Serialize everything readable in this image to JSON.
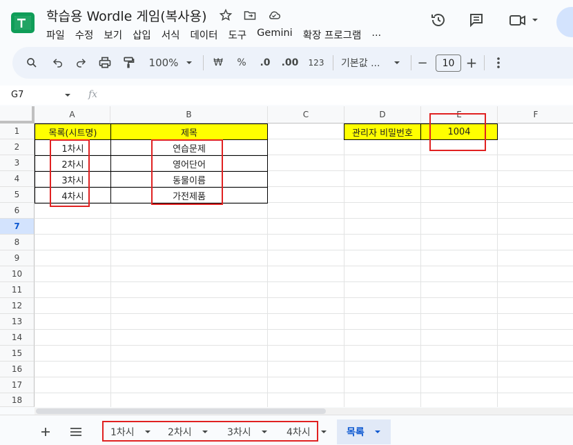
{
  "doc": {
    "title": "학습용 Wordle 게임(복사용)"
  },
  "menu": [
    "파일",
    "수정",
    "보기",
    "삽입",
    "서식",
    "데이터",
    "도구",
    "Gemini",
    "확장 프로그램",
    "..."
  ],
  "toolbar": {
    "zoom": "100%",
    "currency": "₩",
    "percent": "%",
    "decimal_decrease": ".0",
    "decimal_increase": ".00",
    "number_format": "123",
    "font": "기본값 ...",
    "font_size": "10",
    "minus": "−",
    "plus": "+"
  },
  "formula_bar": {
    "cell_ref": "G7",
    "fx": "fx"
  },
  "columns": [
    "A",
    "B",
    "C",
    "D",
    "E",
    "F"
  ],
  "rows": [
    "1",
    "2",
    "3",
    "4",
    "5",
    "6",
    "7",
    "8",
    "9",
    "10",
    "11",
    "12",
    "13",
    "14",
    "15",
    "16",
    "17",
    "18"
  ],
  "selected_row": "7",
  "cells": {
    "A1": "목록(시트명)",
    "B1": "제목",
    "A2": "1차시",
    "B2": "연습문제",
    "A3": "2차시",
    "B3": "영어단어",
    "A4": "3차시",
    "B4": "동물이름",
    "A5": "4차시",
    "B5": "가전제품",
    "D1": "관리자 비밀번호",
    "E1": "1004"
  },
  "sheets": [
    {
      "name": "1차시",
      "active": false
    },
    {
      "name": "2차시",
      "active": false
    },
    {
      "name": "3차시",
      "active": false
    },
    {
      "name": "4차시",
      "active": false
    },
    {
      "name": "목록",
      "active": true
    }
  ],
  "colors": {
    "highlight": "#ffff00",
    "annotation": "#e02020",
    "accent": "#0b57d0"
  }
}
